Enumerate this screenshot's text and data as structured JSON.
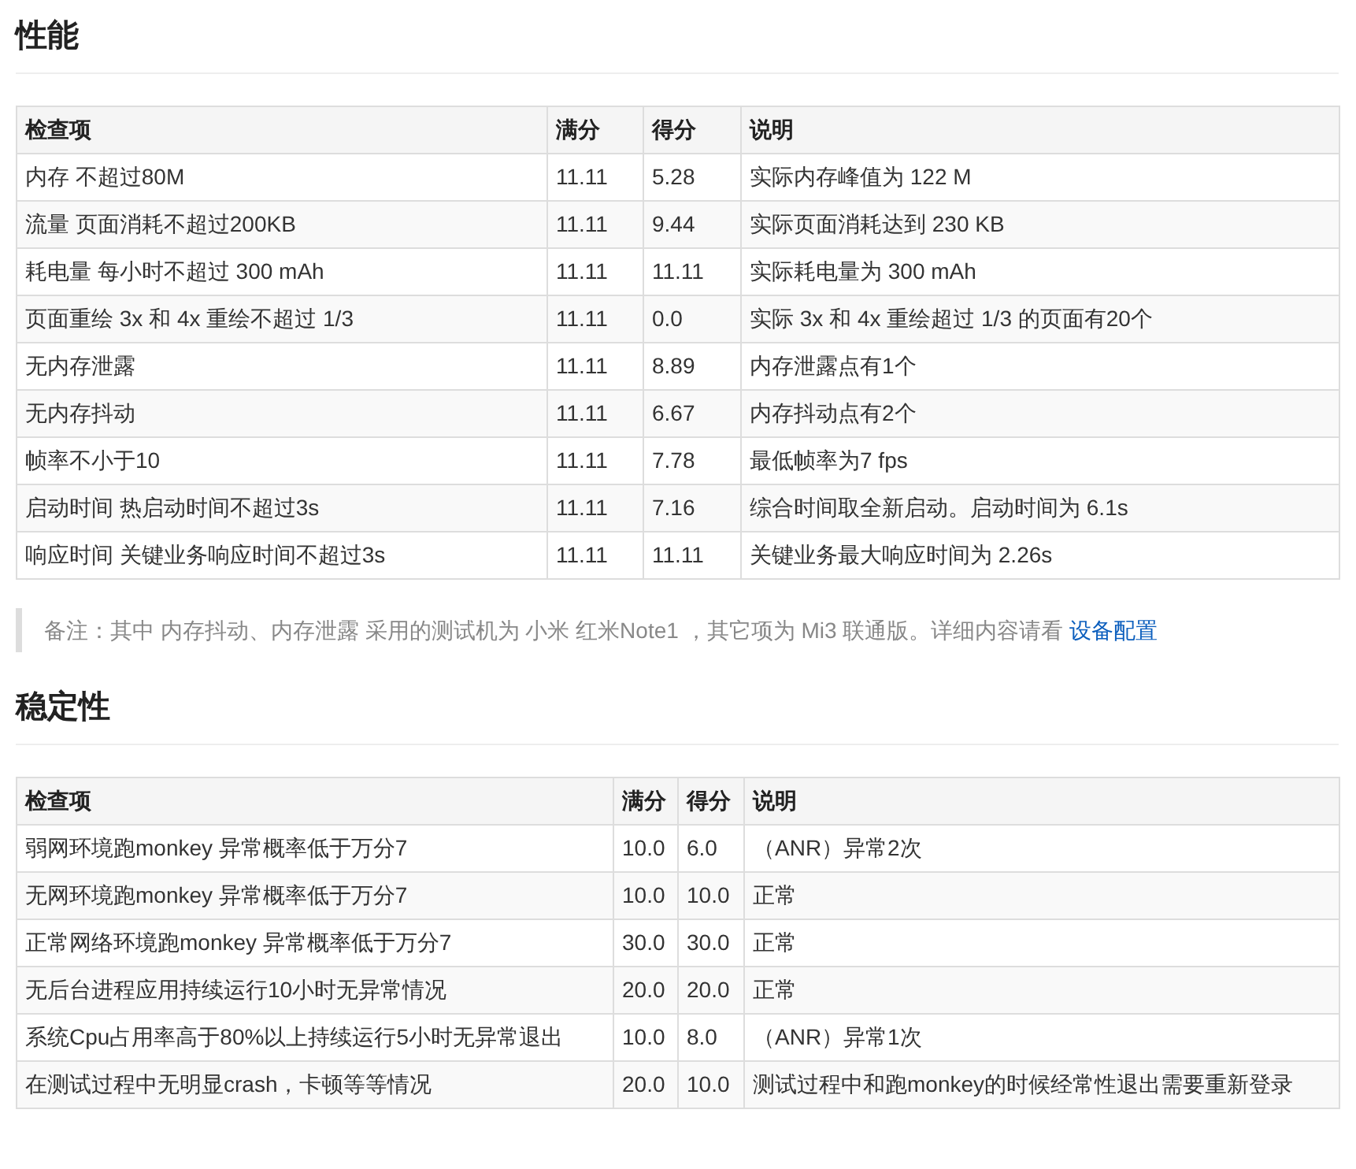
{
  "sections": [
    {
      "heading": "性能",
      "table": {
        "columns": [
          "检查项",
          "满分",
          "得分",
          "说明"
        ],
        "rows": [
          [
            "内存 不超过80M",
            "11.11",
            "5.28",
            "实际内存峰值为 122 M"
          ],
          [
            "流量 页面消耗不超过200KB",
            "11.11",
            "9.44",
            "实际页面消耗达到 230 KB"
          ],
          [
            "耗电量 每小时不超过 300 mAh",
            "11.11",
            "11.11",
            "实际耗电量为 300 mAh"
          ],
          [
            "页面重绘 3x 和 4x 重绘不超过 1/3",
            "11.11",
            "0.0",
            "实际 3x 和 4x 重绘超过 1/3 的页面有20个"
          ],
          [
            "无内存泄露",
            "11.11",
            "8.89",
            "内存泄露点有1个"
          ],
          [
            "无内存抖动",
            "11.11",
            "6.67",
            "内存抖动点有2个"
          ],
          [
            "帧率不小于10",
            "11.11",
            "7.78",
            "最低帧率为7 fps"
          ],
          [
            "启动时间 热启动时间不超过3s",
            "11.11",
            "7.16",
            "综合时间取全新启动。启动时间为 6.1s"
          ],
          [
            "响应时间 关键业务响应时间不超过3s",
            "11.11",
            "11.11",
            "关键业务最大响应时间为 2.26s"
          ]
        ]
      },
      "note": {
        "text": "备注：其中 内存抖动、内存泄露 采用的测试机为 小米 红米Note1 ，其它项为 Mi3 联通版。详细内容请看",
        "link": "设备配置"
      }
    },
    {
      "heading": "稳定性",
      "table": {
        "columns": [
          "检查项",
          "满分",
          "得分",
          "说明"
        ],
        "rows": [
          [
            "弱网环境跑monkey 异常概率低于万分7",
            "10.0",
            "6.0",
            "（ANR）异常2次"
          ],
          [
            "无网环境跑monkey 异常概率低于万分7",
            "10.0",
            "10.0",
            "正常"
          ],
          [
            "正常网络环境跑monkey 异常概率低于万分7",
            "30.0",
            "30.0",
            "正常"
          ],
          [
            "无后台进程应用持续运行10小时无异常情况",
            "20.0",
            "20.0",
            "正常"
          ],
          [
            "系统Cpu占用率高于80%以上持续运行5小时无异常退出",
            "10.0",
            "8.0",
            "（ANR）异常1次"
          ],
          [
            "在测试过程中无明显crash，卡顿等等情况",
            "20.0",
            "10.0",
            "测试过程中和跑monkey的时候经常性退出需要重新登录"
          ]
        ]
      }
    }
  ]
}
